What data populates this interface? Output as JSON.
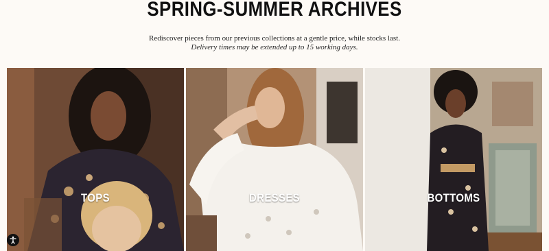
{
  "header": {
    "title": "SPRING-SUMMER ARCHIVES",
    "subtitle": "Rediscover pieces from our previous collections at a gentle price, while stocks last.",
    "note": "Delivery times may be extended up to 15 working days."
  },
  "categories": [
    {
      "label": "TOPS"
    },
    {
      "label": "DRESSES"
    },
    {
      "label": "BOTTOMS"
    }
  ],
  "accessibility": {
    "icon": "accessibility-icon"
  }
}
